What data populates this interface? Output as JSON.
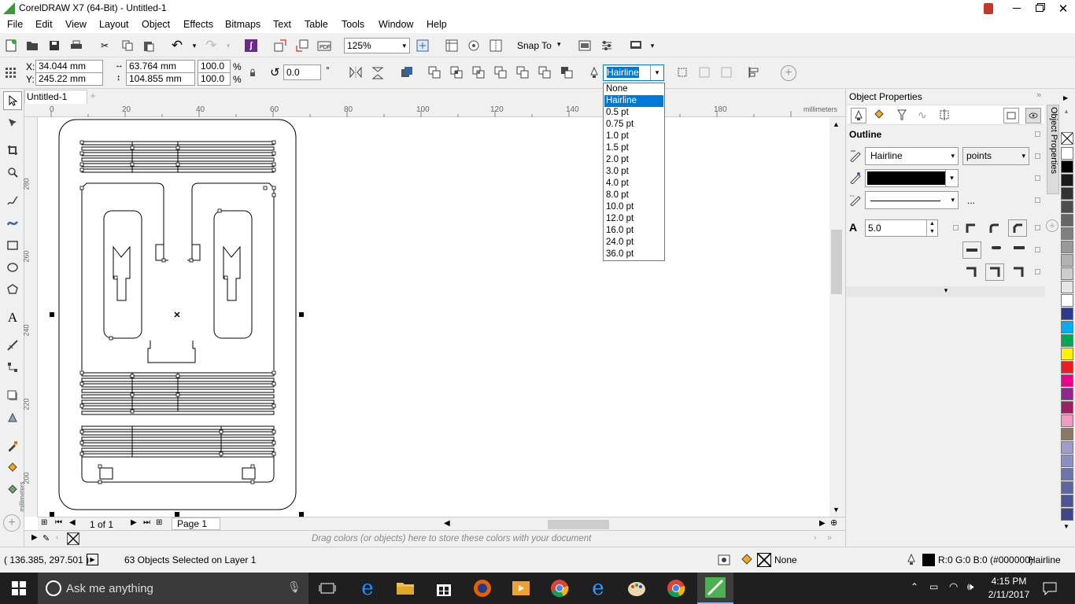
{
  "window": {
    "title": "CorelDRAW X7 (64-Bit) - Untitled-1"
  },
  "menu": [
    "File",
    "Edit",
    "View",
    "Layout",
    "Object",
    "Effects",
    "Bitmaps",
    "Text",
    "Table",
    "Tools",
    "Window",
    "Help"
  ],
  "toolbar": {
    "zoom": "125%",
    "snap_to": "Snap To"
  },
  "propbar": {
    "x": "34.044 mm",
    "y": "245.22 mm",
    "w": "63.764 mm",
    "h": "104.855 mm",
    "sx": "100.0",
    "sy": "100.0",
    "pct": "%",
    "angle": "0.0",
    "deg": "°",
    "outline": "Hairline"
  },
  "outline_dropdown": {
    "options": [
      "None",
      "Hairline",
      "0.5 pt",
      "0.75 pt",
      "1.0 pt",
      "1.5 pt",
      "2.0 pt",
      "3.0 pt",
      "4.0 pt",
      "8.0 pt",
      "10.0 pt",
      "12.0 pt",
      "16.0 pt",
      "24.0 pt",
      "36.0 pt"
    ],
    "selected": "Hairline"
  },
  "document": {
    "tab": "Untitled-1"
  },
  "ruler": {
    "h_ticks": [
      "0",
      "20",
      "40",
      "60",
      "80",
      "100",
      "120",
      "140",
      "160",
      "180"
    ],
    "units": "millimeters",
    "v_ticks": [
      "280",
      "260",
      "240",
      "220",
      "200"
    ],
    "v_units": "millimeters"
  },
  "page_nav": {
    "counter": "1 of 1",
    "page_tab": "Page 1"
  },
  "color_tray": {
    "hint": "Drag colors (or objects) here to store these colors with your document"
  },
  "docker": {
    "title": "Object Properties",
    "vertical_tab": "Object Properties",
    "section": "Outline",
    "width_value": "Hairline",
    "units": "points",
    "miter": "5.0",
    "more": "..."
  },
  "palette_colors": [
    "#ffffff",
    "#000000",
    "#1a1a1a",
    "#333333",
    "#4d4d4d",
    "#666666",
    "#808080",
    "#999999",
    "#b3b3b3",
    "#cccccc",
    "#e6e6e6",
    "#ffffff",
    "#2b3990",
    "#00aeef",
    "#00a651",
    "#fff200",
    "#ed1c24",
    "#ec008c",
    "#92278f",
    "#9e1f63",
    "#f49ac1",
    "#8c7964",
    "#a09ec8",
    "#8c8fc2",
    "#6e73b0",
    "#5f64a3",
    "#4e5597",
    "#3f478b"
  ],
  "status": {
    "cursor": "( 136.385, 297.501 )",
    "selection": "63 Objects Selected on Layer 1",
    "fill": "None",
    "outline_color": "R:0 G:0 B:0 (#000000)",
    "outline_width": "Hairline"
  },
  "taskbar": {
    "search": "Ask me anything",
    "time": "4:15 PM",
    "date": "2/11/2017"
  }
}
